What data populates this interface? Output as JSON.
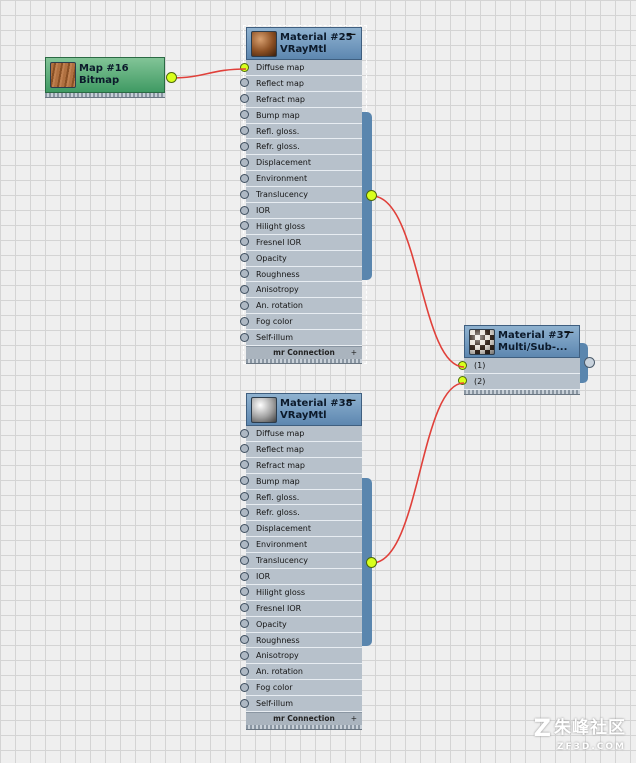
{
  "nodes": {
    "map16": {
      "name": "Map #16",
      "type": "Bitmap"
    },
    "mat25": {
      "name": "Material #25",
      "type": "VRayMtl",
      "minimize": "—",
      "slots": [
        "Diffuse map",
        "Reflect map",
        "Refract map",
        "Bump map",
        "Refl. gloss.",
        "Refr. gloss.",
        "Displacement",
        "Environment",
        "Translucency",
        "IOR",
        "Hilight gloss",
        "Fresnel IOR",
        "Opacity",
        "Roughness",
        "Anisotropy",
        "An. rotation",
        "Fog color",
        "Self-illum"
      ],
      "footer": "mr Connection",
      "footer_icon": "+"
    },
    "mat38": {
      "name": "Material #38",
      "type": "VRayMtl",
      "minimize": "—",
      "slots": [
        "Diffuse map",
        "Reflect map",
        "Refract map",
        "Bump map",
        "Refl. gloss.",
        "Refr. gloss.",
        "Displacement",
        "Environment",
        "Translucency",
        "IOR",
        "Hilight gloss",
        "Fresnel IOR",
        "Opacity",
        "Roughness",
        "Anisotropy",
        "An. rotation",
        "Fog color",
        "Self-illum"
      ],
      "footer": "mr Connection",
      "footer_icon": "+"
    },
    "mat37": {
      "name": "Material #37",
      "type": "Multi/Sub-...",
      "minimize": "—",
      "slots": [
        "(1)",
        "(2)"
      ]
    }
  },
  "watermark": {
    "line1": "朱峰社区",
    "line2": "ZF3D.COM",
    "glyph": "Z"
  },
  "colors": {
    "wire": "#e0403a",
    "socket_active": "#d8ff1c",
    "header_blue": "#6f96bc",
    "header_green": "#5fae7c"
  }
}
